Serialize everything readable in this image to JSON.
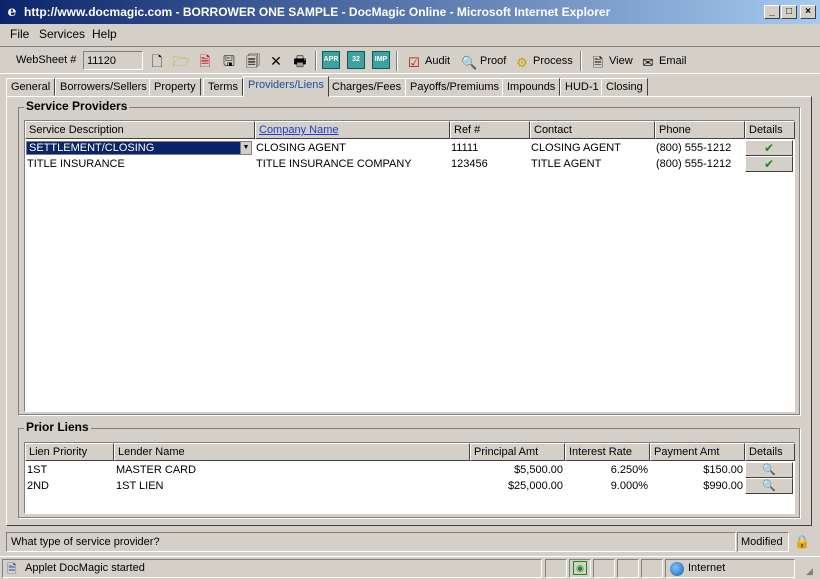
{
  "window": {
    "title": "http://www.docmagic.com - BORROWER ONE SAMPLE - DocMagic Online - Microsoft Internet Explorer",
    "minimize": "_",
    "maximize": "□",
    "close": "×"
  },
  "menu": {
    "file": "File",
    "services": "Services",
    "help": "Help"
  },
  "toolbar": {
    "websheet_label": "WebSheet #",
    "websheet_value": "11120",
    "mini1": "APR",
    "mini2": "32",
    "mini3": "IMP",
    "audit": "Audit",
    "proof": "Proof",
    "process": "Process",
    "view": "View",
    "email": "Email"
  },
  "tabs": [
    {
      "label": "General"
    },
    {
      "label": "Borrowers/Sellers"
    },
    {
      "label": "Property"
    },
    {
      "label": "Terms"
    },
    {
      "label": "Providers/Liens"
    },
    {
      "label": "Charges/Fees"
    },
    {
      "label": "Payoffs/Premiums"
    },
    {
      "label": "Impounds"
    },
    {
      "label": "HUD-1"
    },
    {
      "label": "Closing"
    }
  ],
  "service_providers": {
    "title": "Service Providers",
    "columns": [
      "Service Description",
      "Company Name",
      "Ref #",
      "Contact",
      "Phone",
      "Details"
    ],
    "rows": [
      {
        "description": "SETTLEMENT/CLOSING",
        "company": "CLOSING AGENT",
        "ref": "11111",
        "contact": "CLOSING AGENT",
        "phone": "(800) 555-1212",
        "details": "✔"
      },
      {
        "description": "TITLE INSURANCE",
        "company": "TITLE INSURANCE COMPANY",
        "ref": "123456",
        "contact": "TITLE AGENT",
        "phone": "(800) 555-1212",
        "details": "✔"
      }
    ]
  },
  "prior_liens": {
    "title": "Prior Liens",
    "columns": [
      "Lien Priority",
      "Lender Name",
      "Principal Amt",
      "Interest Rate",
      "Payment Amt",
      "Details"
    ],
    "rows": [
      {
        "priority": "1ST",
        "lender": "MASTER CARD",
        "principal": "$5,500.00",
        "rate": "6.250%",
        "payment": "$150.00",
        "details": "🔍"
      },
      {
        "priority": "2ND",
        "lender": "1ST LIEN",
        "principal": "$25,000.00",
        "rate": "9.000%",
        "payment": "$990.00",
        "details": "🔍"
      }
    ]
  },
  "status": {
    "hint": "What type of service provider?",
    "modified": "Modified",
    "applet": "Applet DocMagic started",
    "zone": "Internet"
  }
}
